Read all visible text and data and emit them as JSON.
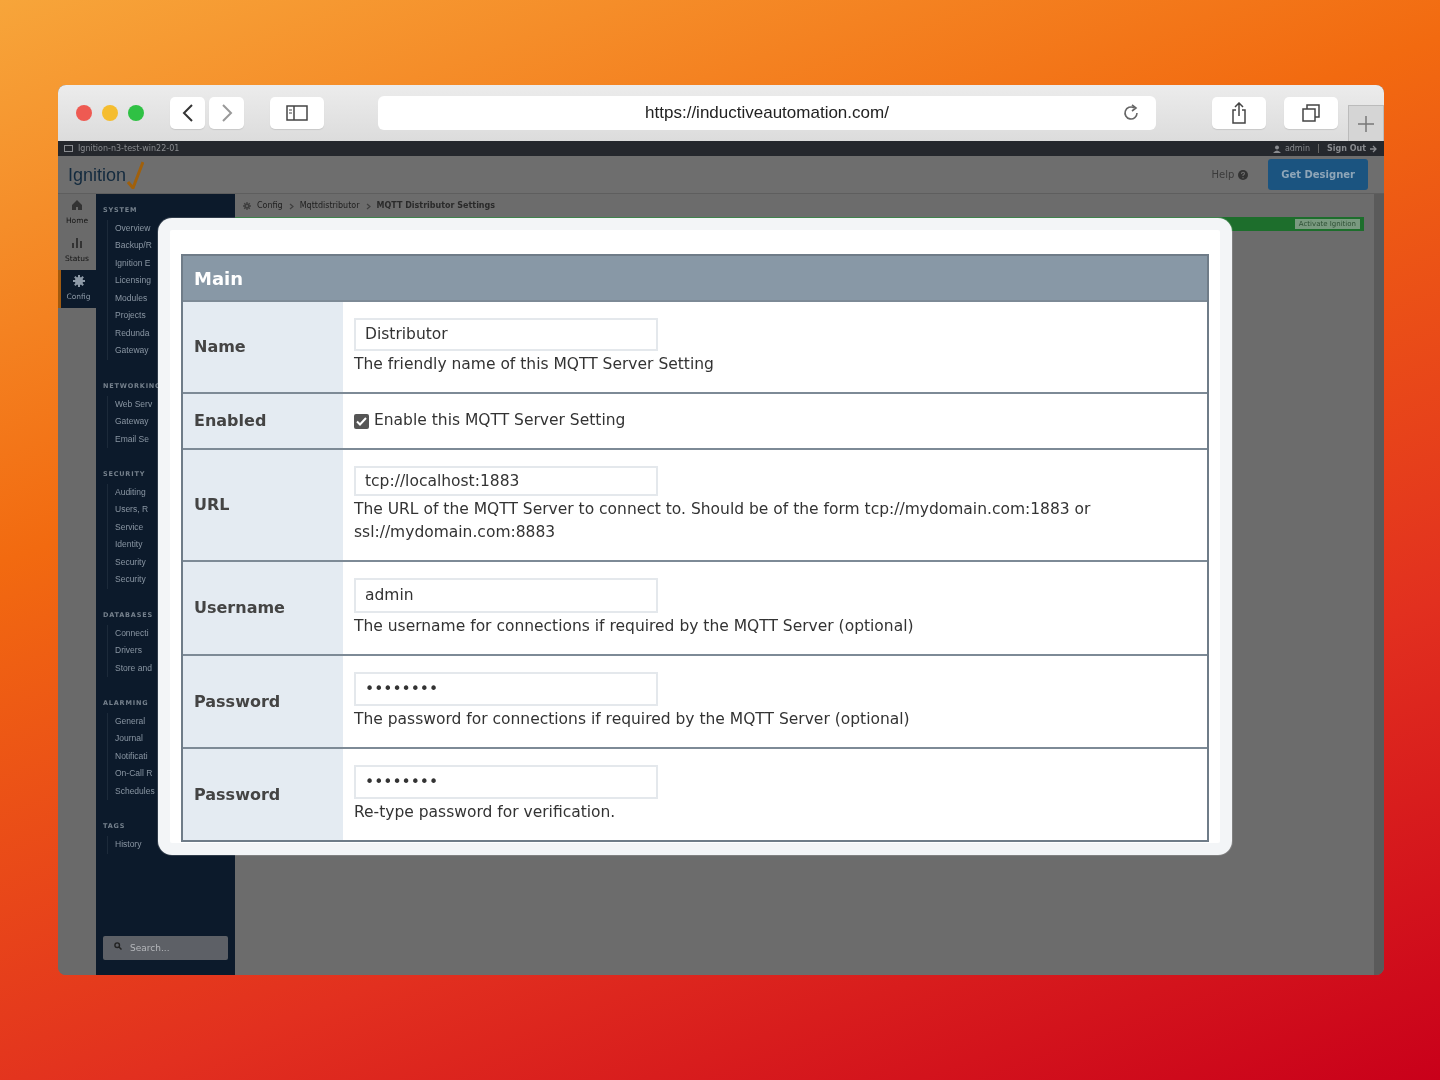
{
  "browser": {
    "url": "https://inductiveautomation.com/"
  },
  "app": {
    "host": "Ignition-n3-test-win22-01",
    "user": "admin",
    "sign_out": "Sign Out",
    "logo": "Ignition",
    "help": "Help",
    "designer_button": "Get Designer",
    "rail": [
      {
        "label": "Home",
        "selected": false
      },
      {
        "label": "Status",
        "selected": false
      },
      {
        "label": "Config",
        "selected": true
      }
    ],
    "sidebar": [
      {
        "title": "SYSTEM",
        "items": [
          "Overview",
          "Backup/R",
          "Ignition E",
          "Licensing",
          "Modules",
          "Projects",
          "Redunda",
          "Gateway"
        ]
      },
      {
        "title": "NETWORKING",
        "items": [
          "Web Serv",
          "Gateway",
          "Email Se"
        ]
      },
      {
        "title": "SECURITY",
        "items": [
          "Auditing",
          "Users, R",
          "Service",
          "Identity",
          "Security",
          "Security"
        ]
      },
      {
        "title": "DATABASES",
        "items": [
          "Connecti",
          "Drivers",
          "Store and"
        ]
      },
      {
        "title": "ALARMING",
        "items": [
          "General",
          "Journal",
          "Notificati",
          "On-Call R",
          "Schedules"
        ]
      },
      {
        "title": "TAGS",
        "items": [
          "History"
        ]
      }
    ],
    "search": {
      "placeholder": "Search..."
    },
    "breadcrumb": [
      "Config",
      "Mqttdistributor",
      "MQTT Distributor Settings"
    ],
    "activate_button": "Activate Ignition"
  },
  "form": {
    "section": "Main",
    "rows": [
      {
        "kind": "text",
        "label": "Name",
        "value": "Distributor",
        "help": "The friendly name of this MQTT Server Setting"
      },
      {
        "kind": "checkbox",
        "label": "Enabled",
        "checked": true,
        "text": "Enable this MQTT Server Setting"
      },
      {
        "kind": "text",
        "label": "URL",
        "value": "tcp://localhost:1883",
        "help": "The URL of the MQTT Server to connect to. Should be of the form tcp://mydomain.com:1883 or ssl://mydomain.com:8883"
      },
      {
        "kind": "text",
        "label": "Username",
        "value": "admin",
        "help": "The username for connections if required by the MQTT Server (optional)"
      },
      {
        "kind": "text",
        "label": "Password",
        "value": "••••••••",
        "help": "The password for connections if required by the MQTT Server (optional)"
      },
      {
        "kind": "text",
        "label": "Password",
        "value": "••••••••",
        "help": "Re-type password for verification."
      }
    ]
  }
}
